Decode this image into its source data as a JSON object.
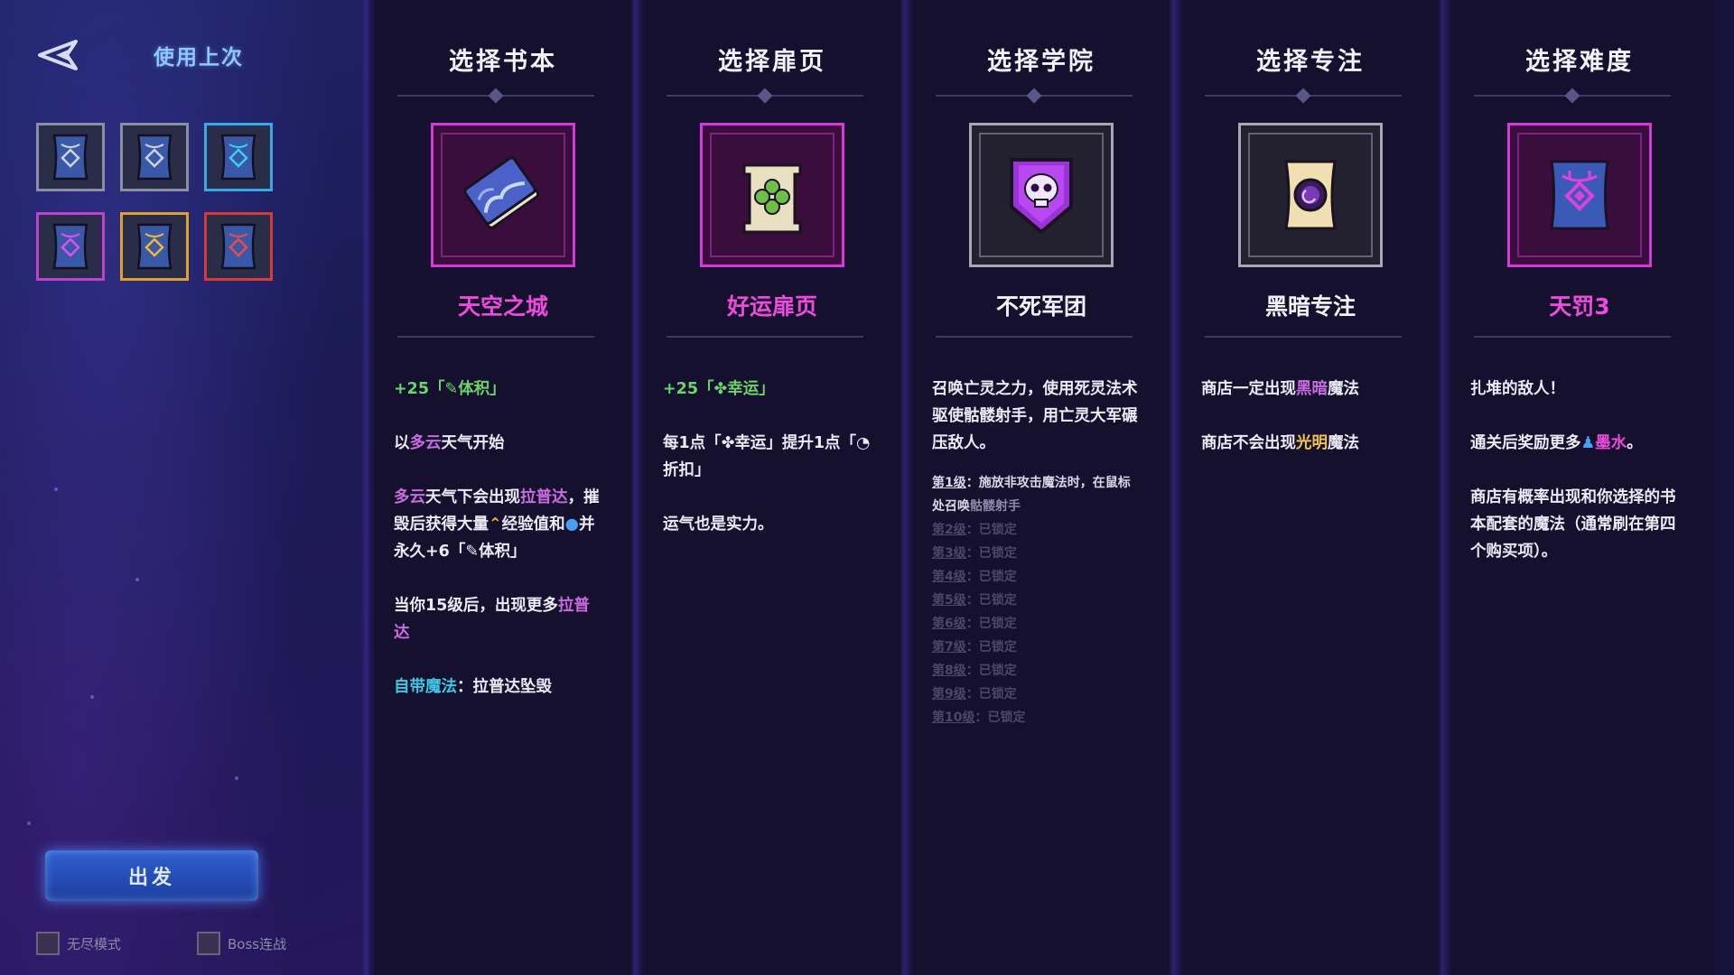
{
  "header": {
    "back_icon": "back-arrow-icon",
    "use_last_label": "使用上次"
  },
  "presets": [
    {
      "icon": "rune-scroll-icon",
      "border": "#8b8fa6",
      "glyph": "#cfd3e8"
    },
    {
      "icon": "rune-scroll-icon",
      "border": "#8b8fa6",
      "glyph": "#cfd3e8"
    },
    {
      "icon": "rune-scroll-icon",
      "border": "#3aa8e8",
      "glyph": "#3ad0f0"
    },
    {
      "icon": "rune-scroll-icon",
      "border": "#c040d0",
      "glyph": "#e050f0"
    },
    {
      "icon": "rune-scroll-icon",
      "border": "#e0a030",
      "glyph": "#f0b832"
    },
    {
      "icon": "rune-scroll-icon",
      "border": "#d83a3a",
      "glyph": "#f04a4a"
    }
  ],
  "depart_label": "出发",
  "toggles": {
    "endless_label": "无尽模式",
    "boss_label": "Boss连战"
  },
  "columns": {
    "book": {
      "title": "选择书本",
      "name": "天空之城",
      "name_color": "#ee4bdc",
      "icon": "sky-book-icon",
      "bonus_value": "+25「",
      "bonus_stat": "体积",
      "bonus_close": "」",
      "line1_a": "以",
      "line1_b": "多云",
      "line1_c": "天气开始",
      "line2_a": "多云",
      "line2_b": "天气下会出现",
      "line2_c": "拉普达",
      "line2_d": "，摧毁后获得大量",
      "line2_e": "经验值和",
      "line2_f": "并永久+6「",
      "line2_g": "体积」",
      "line3_a": "当你15级后，出现更多",
      "line3_b": "拉普达",
      "line4_a": "自带魔法",
      "line4_b": "：拉普达坠毁"
    },
    "page": {
      "title": "选择扉页",
      "name": "好运扉页",
      "name_color": "#ee4bdc",
      "icon": "luck-clover-scroll-icon",
      "bonus_value": "+25「",
      "bonus_stat": "幸运",
      "bonus_close": "」",
      "line1_a": "每1点「",
      "line1_b": "幸运」提升1点「",
      "line1_c": "折扣」",
      "line2": "运气也是实力。"
    },
    "academy": {
      "title": "选择学院",
      "name": "不死军团",
      "name_color": "#f4f2ff",
      "icon": "skull-banner-icon",
      "desc": "召唤亡灵之力，使用死灵法术驱使骷髅射手，用亡灵大军碾压敌人。",
      "level1_label": "第1级",
      "level1_text": "：施放非攻击魔法时，在鼠标处召唤",
      "level1_highlight": "骷髅射手",
      "locked_levels": [
        "第2级",
        "第3级",
        "第4级",
        "第5级",
        "第6级",
        "第7级",
        "第8级",
        "第9级",
        "第10级"
      ],
      "locked_text": "：已锁定"
    },
    "focus": {
      "title": "选择专注",
      "name": "黑暗专注",
      "name_color": "#f4f2ff",
      "icon": "dark-orb-scroll-icon",
      "line1_a": "商店一定出现",
      "line1_b": "黑暗",
      "line1_c": "魔法",
      "line2_a": "商店不会出现",
      "line2_b": "光明",
      "line2_c": "魔法"
    },
    "difficulty": {
      "title": "选择难度",
      "name": "天罚3",
      "name_color": "#ee4bdc",
      "icon": "punishment-rune-scroll-icon",
      "line1": "扎堆的敌人！",
      "line2_a": "通关后奖励更多",
      "line2_b": "墨水",
      "line2_c": "。",
      "line3": "商店有概率出现和你选择的书本配套的魔法（通常刷在第四个购买项）。"
    }
  }
}
